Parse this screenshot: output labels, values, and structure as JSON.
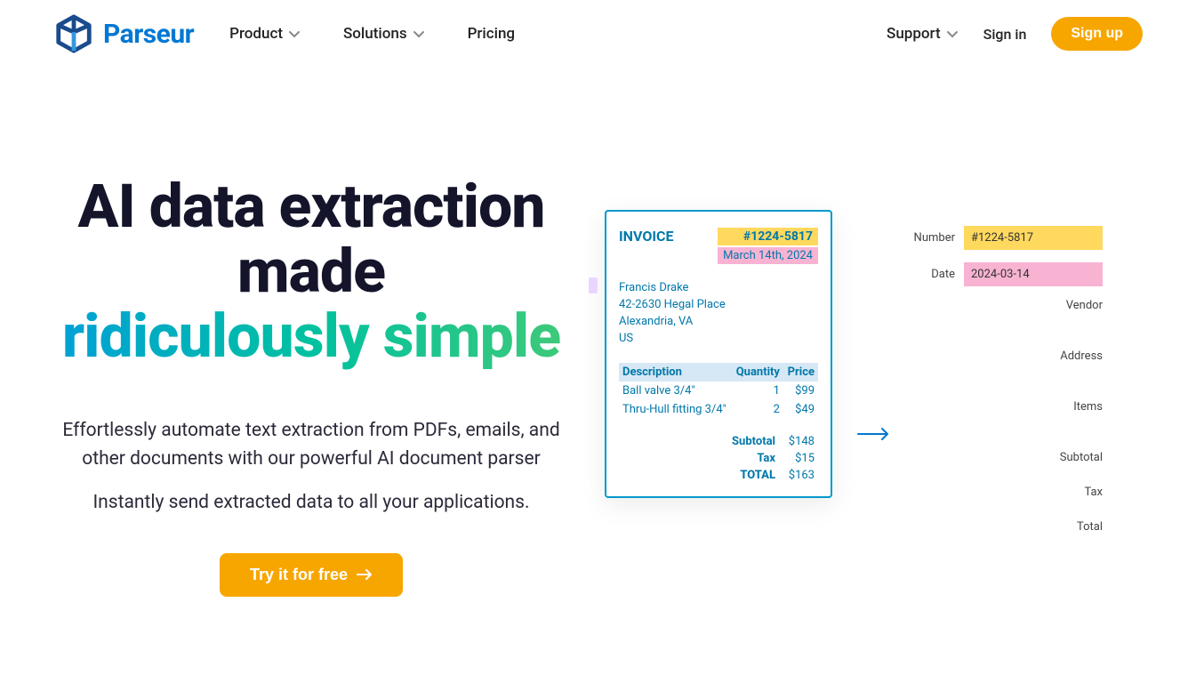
{
  "brand": "Parseur",
  "nav": {
    "product": "Product",
    "solutions": "Solutions",
    "pricing": "Pricing",
    "support": "Support",
    "signin": "Sign in",
    "signup": "Sign up"
  },
  "hero": {
    "title_line1": "AI data extraction made",
    "title_accent": "ridiculously simple",
    "subtitle": "Effortlessly automate text extraction from PDFs, emails, and other documents with our powerful AI document parser",
    "subtitle2": "Instantly send extracted data to all your applications.",
    "cta": "Try it for free"
  },
  "invoice": {
    "heading": "INVOICE",
    "number": "#1224-5817",
    "date": "March 14th, 2024",
    "addr": {
      "name": "Francis Drake",
      "street": "42-2630 Hegal Place",
      "city": "Alexandria, VA",
      "country": "US"
    },
    "columns": {
      "desc": "Description",
      "qty": "Quantity",
      "price": "Price"
    },
    "items": [
      {
        "desc": "Ball valve 3/4\"",
        "qty": "1",
        "price": "$99"
      },
      {
        "desc": "Thru-Hull fitting 3/4\"",
        "qty": "2",
        "price": "$49"
      }
    ],
    "totals": {
      "subtotal_label": "Subtotal",
      "subtotal": "$148",
      "tax_label": "Tax",
      "tax": "$15",
      "total_label": "TOTAL",
      "total": "$163"
    }
  },
  "extracted": {
    "number_label": "Number",
    "number": "#1224-5817",
    "date_label": "Date",
    "date": "2024-03-14",
    "vendor_label": "Vendor",
    "address_label": "Address",
    "items_label": "Items",
    "subtotal_label": "Subtotal",
    "tax_label": "Tax",
    "total_label": "Total"
  }
}
